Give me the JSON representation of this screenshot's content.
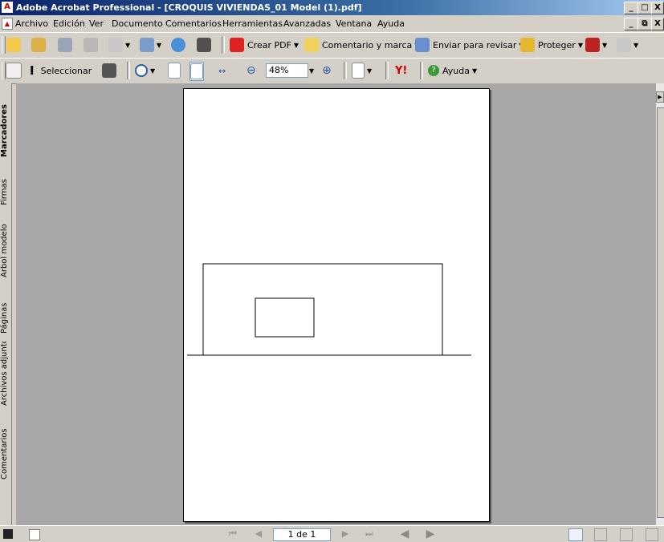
{
  "window": {
    "title": "Adobe Acrobat Professional - [CROQUIS VIVIENDAS_01 Model (1).pdf]",
    "buttons": [
      "_",
      "□",
      "X"
    ]
  },
  "menubar": {
    "items": [
      "Archivo",
      "Edición",
      "Ver",
      "Documento",
      "Comentarios",
      "Herramientas",
      "Avanzadas",
      "Ventana",
      "Ayuda"
    ],
    "doc_buttons": [
      "_",
      "⧉",
      "X"
    ]
  },
  "toolbar1": {
    "create_pdf": "Crear PDF",
    "comment_markup": "Comentario y marca",
    "send_review": "Enviar para revisar",
    "protect": "Proteger"
  },
  "toolbar2": {
    "select": "Seleccionar",
    "zoom_value": "48%",
    "help": "Ayuda"
  },
  "navpanel": {
    "tabs": [
      "Marcadores",
      "Firmas",
      "Árbol modelo",
      "Páginas",
      "Archivos adjuntos",
      "Comentarios"
    ]
  },
  "statusbar": {
    "page_indicator": "1 de 1"
  },
  "colors": {
    "titlebar_start": "#0a246a",
    "titlebar_end": "#a6caf0",
    "chrome": "#d4d0c8",
    "doc_background": "#a8a8a8"
  }
}
